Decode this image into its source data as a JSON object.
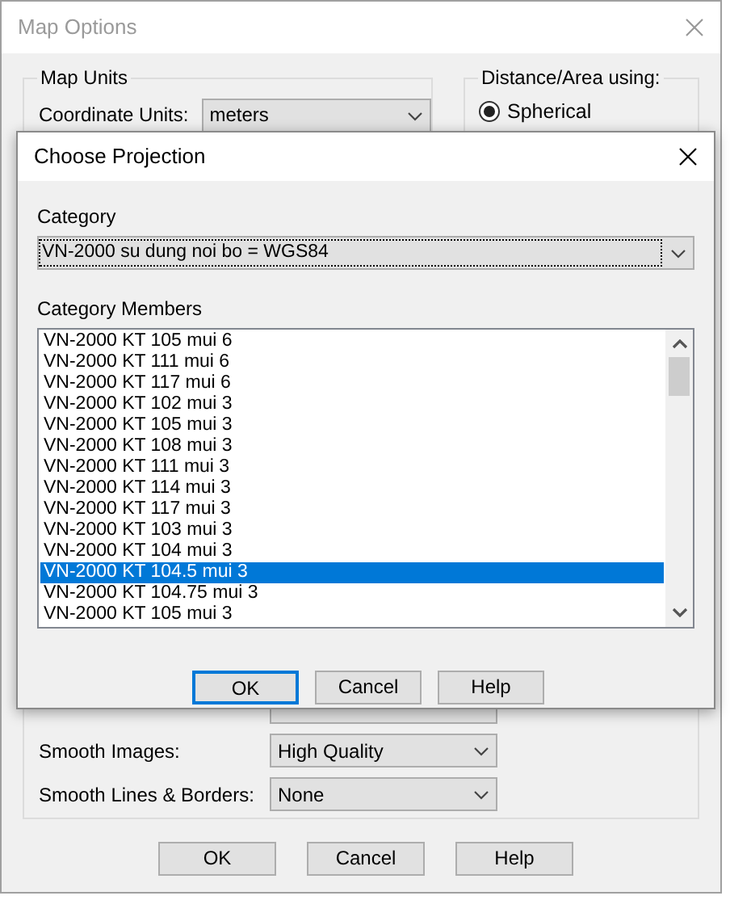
{
  "main_window": {
    "title": "Map Options",
    "map_units": {
      "label": "Map Units",
      "coordinate_units": {
        "label": "Coordinate Units:",
        "value": "meters"
      }
    },
    "distance_area": {
      "label": "Distance/Area using:",
      "options": [
        {
          "label": "Spherical",
          "selected": true
        }
      ]
    },
    "smoothing": [
      {
        "label": "Smooth Images:",
        "value": "High Quality"
      },
      {
        "label": "Smooth Lines & Borders:",
        "value": "None"
      }
    ],
    "buttons": [
      "OK",
      "Cancel",
      "Help"
    ]
  },
  "dialog": {
    "title": "Choose Projection",
    "category_label": "Category",
    "category_value": "VN-2000 su dung noi bo = WGS84",
    "members_label": "Category Members",
    "members": [
      {
        "label": "VN-2000 KT 105 mui 6",
        "selected": false
      },
      {
        "label": "VN-2000 KT 111 mui 6",
        "selected": false
      },
      {
        "label": "VN-2000 KT 117 mui 6",
        "selected": false
      },
      {
        "label": "VN-2000 KT 102 mui 3",
        "selected": false
      },
      {
        "label": "VN-2000 KT 105 mui 3",
        "selected": false
      },
      {
        "label": "VN-2000 KT 108 mui 3",
        "selected": false
      },
      {
        "label": "VN-2000 KT 111 mui 3",
        "selected": false
      },
      {
        "label": "VN-2000 KT 114 mui 3",
        "selected": false
      },
      {
        "label": "VN-2000 KT 117 mui 3",
        "selected": false
      },
      {
        "label": "VN-2000 KT 103 mui 3",
        "selected": false
      },
      {
        "label": "VN-2000 KT 104 mui 3",
        "selected": false
      },
      {
        "label": "VN-2000 KT 104.5 mui 3",
        "selected": true
      },
      {
        "label": "VN-2000 KT 104.75 mui 3",
        "selected": false
      },
      {
        "label": "VN-2000 KT 105 mui 3",
        "selected": false
      }
    ],
    "buttons": [
      {
        "label": "OK",
        "default": true
      },
      {
        "label": "Cancel",
        "default": false
      },
      {
        "label": "Help",
        "default": false
      }
    ]
  }
}
